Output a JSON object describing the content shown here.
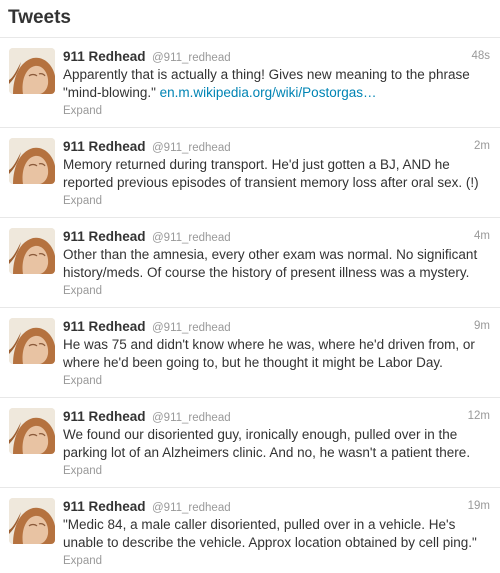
{
  "header": {
    "title": "Tweets"
  },
  "colors": {
    "link": "#0084b4",
    "meta": "#999999",
    "text": "#333333",
    "divider": "#e8e8e8"
  },
  "tweets": [
    {
      "author": "911 Redhead",
      "handle": "@911_redhead",
      "time": "48s",
      "lines": [
        "Apparently that is actually a thing! Gives new meaning to the phrase",
        "\"mind-blowing.\" "
      ],
      "link": "en.m.wikipedia.org/wiki/Postorgas…",
      "expand": "Expand",
      "avatar_icon": "profile-photo-icon"
    },
    {
      "author": "911 Redhead",
      "handle": "@911_redhead",
      "time": "2m",
      "lines": [
        "Memory returned during transport. He'd just gotten a BJ, AND he",
        "reported previous episodes of transient memory loss after oral sex. (!)"
      ],
      "link": "",
      "expand": "Expand",
      "avatar_icon": "profile-photo-icon"
    },
    {
      "author": "911 Redhead",
      "handle": "@911_redhead",
      "time": "4m",
      "lines": [
        "Other than the amnesia, every other exam was normal. No significant",
        "history/meds. Of course the history of present illness was a mystery."
      ],
      "link": "",
      "expand": "Expand",
      "avatar_icon": "profile-photo-icon"
    },
    {
      "author": "911 Redhead",
      "handle": "@911_redhead",
      "time": "9m",
      "lines": [
        "He was 75 and didn't know where he was, where he'd driven from, or",
        "where he'd been going to, but he thought it might be Labor Day."
      ],
      "link": "",
      "expand": "Expand",
      "avatar_icon": "profile-photo-icon"
    },
    {
      "author": "911 Redhead",
      "handle": "@911_redhead",
      "time": "12m",
      "lines": [
        "We found our disoriented guy, ironically enough, pulled over in the",
        "parking lot of an Alzheimers clinic. And no, he wasn't a patient there."
      ],
      "link": "",
      "expand": "Expand",
      "avatar_icon": "profile-photo-icon"
    },
    {
      "author": "911 Redhead",
      "handle": "@911_redhead",
      "time": "19m",
      "lines": [
        "\"Medic 84, a male caller disoriented, pulled over in a vehicle. He's",
        "unable to describe the vehicle. Approx location obtained by cell ping.\""
      ],
      "link": "",
      "expand": "Expand",
      "avatar_icon": "profile-photo-icon"
    }
  ]
}
